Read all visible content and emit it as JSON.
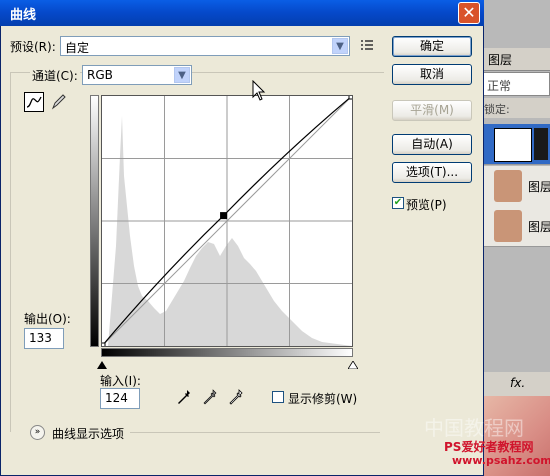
{
  "dialog": {
    "title": "曲线",
    "close_glyph": "✕",
    "preset_label": "预设(R):",
    "preset_value": "自定",
    "channel_label": "通道(C):",
    "channel_value": "RGB",
    "output_label": "输出(O):",
    "output_value": "133",
    "input_label": "输入(I):",
    "input_value": "124",
    "show_clipping_label": "显示修剪(W)",
    "show_clipping_checked": false,
    "curve_options_label": "曲线显示选项",
    "buttons": {
      "ok": "确定",
      "cancel": "取消",
      "smooth": "平滑(M)",
      "auto": "自动(A)",
      "options": "选项(T)..."
    },
    "preview_label": "预览(P)",
    "preview_checked": true
  },
  "layers_panel": {
    "tab_label": "图层",
    "blend_mode": "正常",
    "lock_label": "锁定:",
    "layer_names": [
      "图层",
      "图层"
    ],
    "fx_label": "fx."
  },
  "watermark": {
    "line1": "中国教程网",
    "line2": "PS爱好者教程网",
    "line3": "www.psahz.com"
  },
  "colors": {
    "titlebar": "#0548c9",
    "dialog_bg": "#ece9d8",
    "selected_layer": "#316ac5"
  },
  "curve": {
    "points": [
      [
        0,
        0
      ],
      [
        124,
        133
      ],
      [
        255,
        255
      ]
    ]
  }
}
